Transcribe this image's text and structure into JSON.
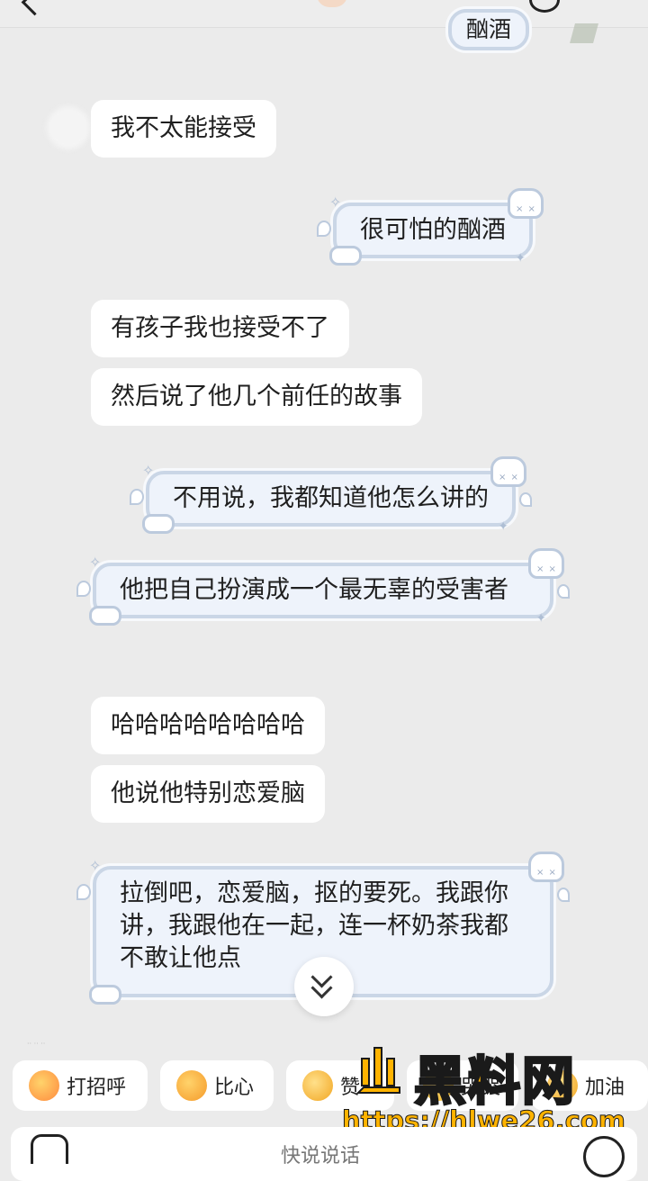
{
  "top_sticker_text": "酗酒",
  "messages": [
    {
      "id": "m1",
      "side": "left",
      "text": "我不太能接受"
    },
    {
      "id": "m2",
      "side": "right",
      "text": "很可怕的酗酒"
    },
    {
      "id": "m3",
      "side": "left",
      "text": "有孩子我也接受不了"
    },
    {
      "id": "m4",
      "side": "left",
      "text": "然后说了他几个前任的故事"
    },
    {
      "id": "m5",
      "side": "right",
      "text": "不用说，我都知道他怎么讲的"
    },
    {
      "id": "m6",
      "side": "right",
      "text": "他把自己扮演成一个最无辜的受害者"
    },
    {
      "id": "m7",
      "side": "left",
      "text": "哈哈哈哈哈哈哈哈"
    },
    {
      "id": "m8",
      "side": "left",
      "text": "他说他特别恋爱脑"
    },
    {
      "id": "m9",
      "side": "right",
      "text": "拉倒吧，恋爱脑，抠的要死。我跟你讲，我跟他在一起，连一杯奶茶我都不敢让他点"
    }
  ],
  "quick_replies": [
    {
      "label": "打招呼",
      "icon": "wave-emoji-icon"
    },
    {
      "label": "比心",
      "icon": "heart-hands-emoji-icon"
    },
    {
      "label": "赞",
      "icon": "thumbs-up-emoji-icon"
    },
    {
      "label": "哭哭",
      "icon": "crying-emoji-icon"
    },
    {
      "label": "加油",
      "icon": "cheer-emoji-icon"
    }
  ],
  "input": {
    "placeholder": "快说说话"
  },
  "watermark": {
    "brand": "黑料网",
    "url": "https://hlwe26.com"
  },
  "colors": {
    "background": "#ebebeb",
    "received_bubble": "#ffffff",
    "sent_bubble": "#eef3fb",
    "sent_border": "#cad6e6",
    "watermark": "#ffb300"
  }
}
